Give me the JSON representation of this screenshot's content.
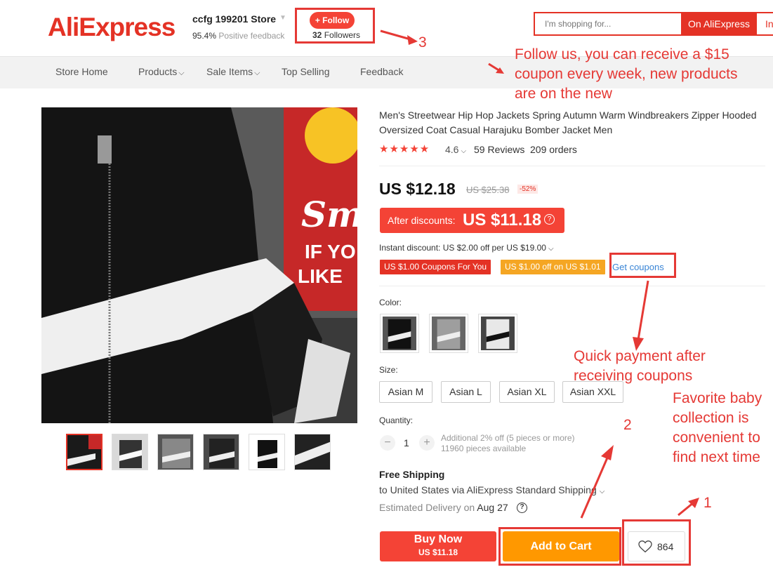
{
  "header": {
    "logo": "AliExpress",
    "store_name": "ccfg 199201 Store",
    "feedback_pct": "95.4%",
    "feedback_label": "Positive feedback",
    "follow_label": "+ Follow",
    "followers_count": "32",
    "followers_label": "Followers",
    "search_placeholder": "I'm shopping for...",
    "search_button": "On AliExpress",
    "search_button2": "In"
  },
  "nav": [
    "Store Home",
    "Products",
    "Sale Items",
    "Top Selling",
    "Feedback"
  ],
  "product": {
    "title": "Men's Streetwear Hip Hop Jackets Spring Autumn Warm Windbreakers Zipper Hooded Oversized Coat Casual Harajuku Bomber Jacket Men",
    "stars": "★★★★★",
    "rating": "4.6",
    "reviews": "59 Reviews",
    "orders": "209 orders",
    "price": "US $12.18",
    "old_price": "US $25.38",
    "discount": "-52%",
    "after_label": "After discounts:",
    "after_value": "US $11.18",
    "instant_discount": "Instant discount: US $2.00 off per US $19.00",
    "coupon1": "US $1.00 Coupons For You",
    "coupon2": "US $1.00 off on US $1.01",
    "get_coupons": "Get coupons",
    "color_label": "Color:",
    "size_label": "Size:",
    "sizes": [
      "Asian M",
      "Asian L",
      "Asian XL",
      "Asian XXL"
    ],
    "quantity_label": "Quantity:",
    "quantity": "1",
    "qty_note1": "Additional 2% off (5 pieces or more)",
    "qty_note2": "11960 pieces available",
    "shipping_title": "Free Shipping",
    "shipping_text": "to United States via AliExpress Standard Shipping",
    "delivery_label": "Estimated Delivery on",
    "delivery_date": "Aug 27",
    "buy_now": "Buy Now",
    "buy_price": "US $11.18",
    "add_to_cart": "Add to Cart",
    "wishlist_count": "864"
  },
  "annotations": {
    "n3": "3",
    "follow_note": "Follow us, you can receive a $15 coupon every week, new products are on the new",
    "coupon_note": "Quick payment after receiving coupons",
    "n2": "2",
    "fav_note": "Favorite baby collection is convenient to find next time",
    "n1": "1"
  },
  "colors": {
    "brand": "#e43225",
    "annotation": "#e53935",
    "cart": "#ff9800"
  }
}
